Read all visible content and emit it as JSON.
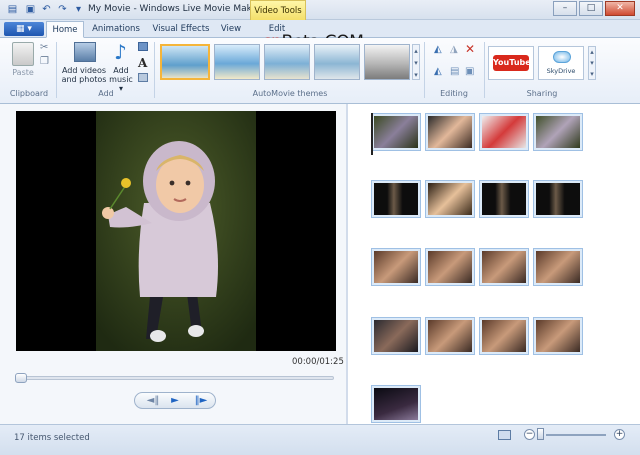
{
  "window": {
    "title": "My Movie - Windows Live Movie Maker B...",
    "context_tab": "Video Tools",
    "minimize": "–",
    "maximize": "□",
    "close": "✕"
  },
  "quick_access": [
    "save-icon",
    "undo-icon",
    "redo-icon",
    "customize-icon"
  ],
  "file_menu": "▦ ▾",
  "tabs": [
    {
      "label": "Home",
      "active": true
    },
    {
      "label": "Animations",
      "active": false
    },
    {
      "label": "Visual Effects",
      "active": false
    },
    {
      "label": "View",
      "active": false
    },
    {
      "label": "Edit",
      "active": false
    }
  ],
  "ribbon": {
    "clipboard": {
      "paste": "Paste",
      "group": "Clipboard"
    },
    "add": {
      "add_videos": "Add videos",
      "and_photos": "and photos",
      "add_music": "Add",
      "music_label": "music ▾",
      "group": "Add"
    },
    "autotmovie_group": "AutoMovie themes",
    "editing_group": "Editing",
    "sharing": {
      "group": "Sharing",
      "youtube": "YouTube",
      "skydrive": "SkyDrive"
    }
  },
  "watermark": {
    "accent": "cn",
    "rest": "Beta.COM"
  },
  "preview": {
    "timecode": "00:00/01:25",
    "progress": 0.0
  },
  "controls": {
    "prev": "◄‖",
    "play": "►",
    "next": "‖►"
  },
  "storyboard": {
    "items": [
      {
        "scene": "girl-outdoor"
      },
      {
        "scene": "girl-hat"
      },
      {
        "scene": "girl-red-hood"
      },
      {
        "scene": "girl-outdoor-2"
      },
      {
        "scene": "dark-door"
      },
      {
        "scene": "girl-closeup"
      },
      {
        "scene": "dark-door"
      },
      {
        "scene": "dark-door"
      },
      {
        "scene": "family-indoor"
      },
      {
        "scene": "family-indoor"
      },
      {
        "scene": "family-indoor"
      },
      {
        "scene": "family-indoor"
      },
      {
        "scene": "family-dark"
      },
      {
        "scene": "family-indoor"
      },
      {
        "scene": "family-indoor"
      },
      {
        "scene": "family-indoor"
      },
      {
        "scene": "night-lights"
      }
    ]
  },
  "status": {
    "text": "17 items selected",
    "zoom_minus": "−",
    "zoom_plus": "+"
  },
  "colors": {
    "accent": "#1e56b0",
    "context_tab": "#f4df6a",
    "selected_theme": "#f5b53a"
  }
}
